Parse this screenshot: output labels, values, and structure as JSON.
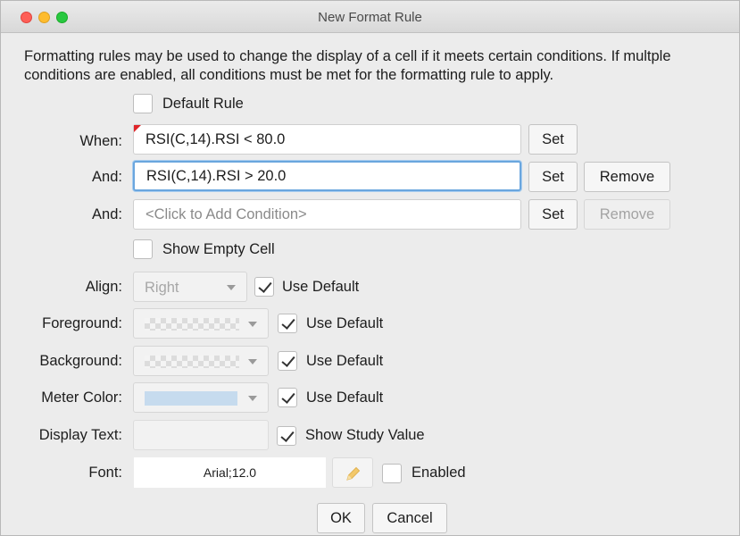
{
  "window": {
    "title": "New Format Rule"
  },
  "description": "Formatting rules may be used to change the display of a cell if it meets certain conditions.  If multple conditions are enabled, all conditions must be met for the formatting rule to apply.",
  "default_rule": {
    "label": "Default Rule",
    "checked": false
  },
  "conditions": [
    {
      "label": "When:",
      "value": "RSI(C,14).RSI < 80.0",
      "set_label": "Set",
      "remove_label": ""
    },
    {
      "label": "And:",
      "value": "RSI(C,14).RSI > 20.0",
      "set_label": "Set",
      "remove_label": "Remove",
      "remove_enabled": true
    },
    {
      "label": "And:",
      "placeholder": "<Click to Add Condition>",
      "set_label": "Set",
      "remove_label": "Remove",
      "remove_enabled": false
    }
  ],
  "show_empty_cell": {
    "label": "Show Empty Cell",
    "checked": false
  },
  "align": {
    "label": "Align:",
    "value": "Right",
    "use_default_label": "Use Default",
    "use_default_checked": true
  },
  "foreground": {
    "label": "Foreground:",
    "use_default_label": "Use Default",
    "use_default_checked": true
  },
  "background": {
    "label": "Background:",
    "use_default_label": "Use Default",
    "use_default_checked": true
  },
  "meter_color": {
    "label": "Meter Color:",
    "color": "#c6dbee",
    "use_default_label": "Use Default",
    "use_default_checked": true
  },
  "display_text": {
    "label": "Display Text:",
    "value": "",
    "show_study_value_label": "Show Study Value",
    "show_study_value_checked": true
  },
  "font": {
    "label": "Font:",
    "value": "Arial;12.0",
    "enabled_label": "Enabled",
    "enabled_checked": false,
    "edit_icon": "pencil-icon"
  },
  "buttons": {
    "ok": "OK",
    "cancel": "Cancel"
  },
  "colors": {
    "focus_ring": "#6aa6de",
    "flag": "#e0252a",
    "close": "#fe5f57",
    "minimize": "#febc2e",
    "maximize": "#28c840"
  }
}
